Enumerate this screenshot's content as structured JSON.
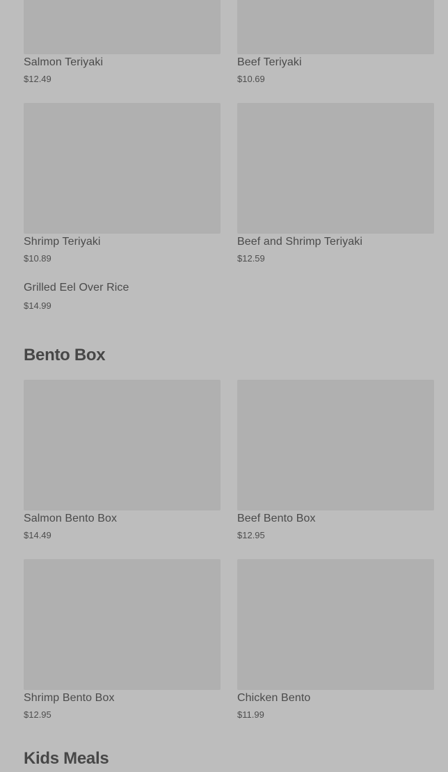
{
  "teriyaki_items": [
    {
      "name": "Salmon Teriyaki",
      "price": "$12.49"
    },
    {
      "name": "Beef Teriyaki",
      "price": "$10.69"
    },
    {
      "name": "Shrimp Teriyaki",
      "price": "$10.89"
    },
    {
      "name": "Beef and Shrimp Teriyaki",
      "price": "$12.59"
    },
    {
      "name": "Grilled Eel Over Rice",
      "price": "$14.99"
    }
  ],
  "bento_section": {
    "title": "Bento Box",
    "items": [
      {
        "name": "Salmon Bento Box",
        "price": "$14.49"
      },
      {
        "name": "Beef Bento Box",
        "price": "$12.95"
      },
      {
        "name": "Shrimp Bento Box",
        "price": "$12.95"
      },
      {
        "name": "Chicken Bento",
        "price": "$11.99"
      }
    ]
  },
  "kids_section": {
    "title": "Kids Meals"
  }
}
